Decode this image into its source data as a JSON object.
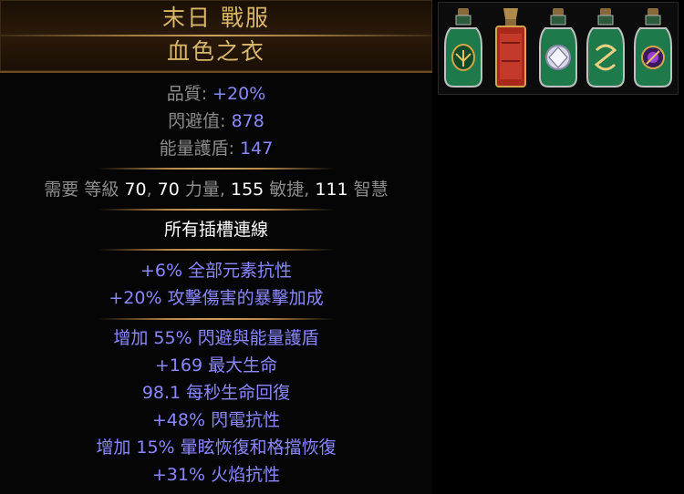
{
  "item": {
    "name_line1": "末日 戰服",
    "name_line2": "血色之衣"
  },
  "properties": [
    {
      "label": "品質: ",
      "value": "+20%"
    },
    {
      "label": "閃避值: ",
      "value": "878"
    },
    {
      "label": "能量護盾: ",
      "value": "147"
    }
  ],
  "requirements": {
    "prefix": "需要 ",
    "level_label": "等級 ",
    "level_value": "70",
    "sep1": ", ",
    "str_value": "70",
    "str_label": " 力量, ",
    "dex_value": "155",
    "dex_label": " 敏捷, ",
    "int_value": "111",
    "int_label": " 智慧"
  },
  "sockets_text": "所有插槽連線",
  "implicit_mods": [
    "+6% 全部元素抗性",
    "+20% 攻擊傷害的暴擊加成"
  ],
  "explicit_mods": [
    "增加 55% 閃避與能量護盾",
    "+169 最大生命",
    "98.1 每秒生命回復",
    "+48% 閃電抗性",
    "增加 15% 暈眩恢復和格擋恢復",
    "+31% 火焰抗性"
  ],
  "colors": {
    "unique_name": "#d8b66a",
    "magic_mod": "#8a87ff",
    "label_grey": "#8c8c8c",
    "value_blue": "#8888ff",
    "value_white": "#ffffff"
  },
  "flasks": [
    {
      "icon": "green-flask-icon"
    },
    {
      "icon": "red-rectangular-flask-icon"
    },
    {
      "icon": "green-diamond-flask-icon"
    },
    {
      "icon": "green-swirl-flask-icon"
    },
    {
      "icon": "green-purple-gem-flask-icon"
    }
  ]
}
